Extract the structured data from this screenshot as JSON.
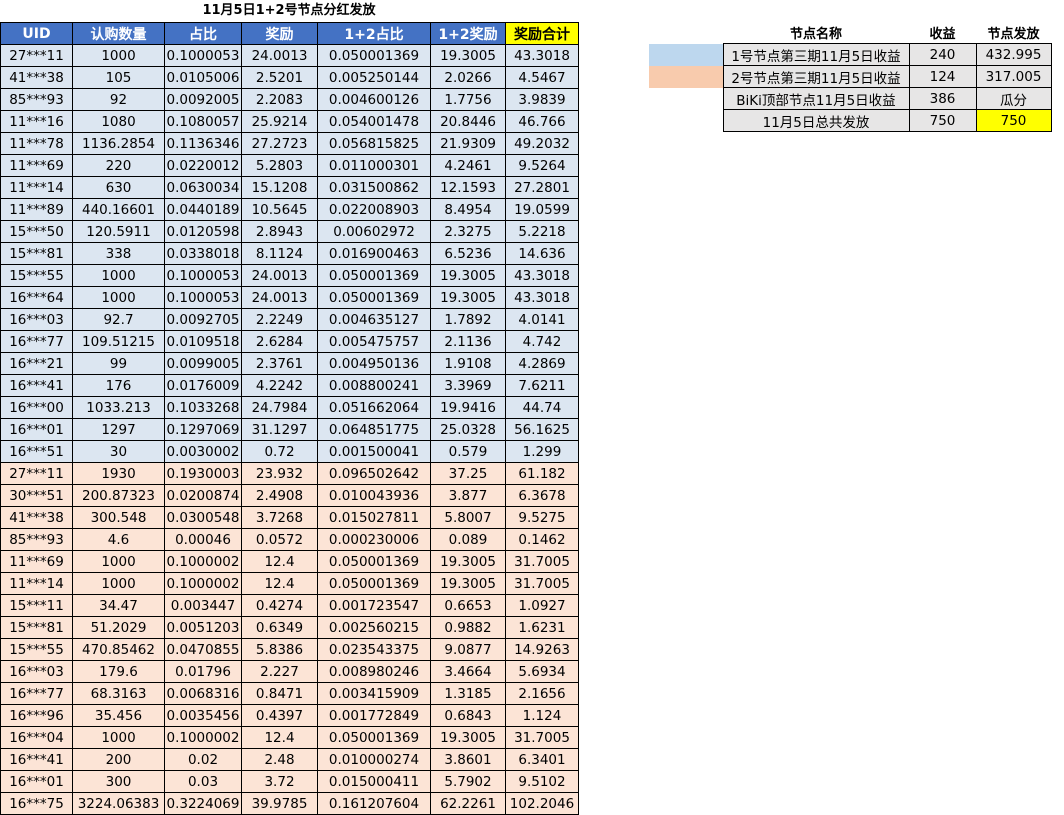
{
  "title": "11月5日1+2号节点分红发放",
  "columns": [
    "UID",
    "认购数量",
    "占比",
    "奖励",
    "1+2占比",
    "1+2奖励",
    "奖励合计"
  ],
  "rows": [
    [
      "27***11",
      "1000",
      "0.1000053",
      "24.0013",
      "0.050001369",
      "19.3005",
      "43.3018"
    ],
    [
      "41***38",
      "105",
      "0.0105006",
      "2.5201",
      "0.005250144",
      "2.0266",
      "4.5467"
    ],
    [
      "85***93",
      "92",
      "0.0092005",
      "2.2083",
      "0.004600126",
      "1.7756",
      "3.9839"
    ],
    [
      "11***16",
      "1080",
      "0.1080057",
      "25.9214",
      "0.054001478",
      "20.8446",
      "46.766"
    ],
    [
      "11***78",
      "1136.2854",
      "0.1136346",
      "27.2723",
      "0.056815825",
      "21.9309",
      "49.2032"
    ],
    [
      "11***69",
      "220",
      "0.0220012",
      "5.2803",
      "0.011000301",
      "4.2461",
      "9.5264"
    ],
    [
      "11***14",
      "630",
      "0.0630034",
      "15.1208",
      "0.031500862",
      "12.1593",
      "27.2801"
    ],
    [
      "11***89",
      "440.16601",
      "0.0440189",
      "10.5645",
      "0.022008903",
      "8.4954",
      "19.0599"
    ],
    [
      "15***50",
      "120.5911",
      "0.0120598",
      "2.8943",
      "0.00602972",
      "2.3275",
      "5.2218"
    ],
    [
      "15***81",
      "338",
      "0.0338018",
      "8.1124",
      "0.016900463",
      "6.5236",
      "14.636"
    ],
    [
      "15***55",
      "1000",
      "0.1000053",
      "24.0013",
      "0.050001369",
      "19.3005",
      "43.3018"
    ],
    [
      "16***64",
      "1000",
      "0.1000053",
      "24.0013",
      "0.050001369",
      "19.3005",
      "43.3018"
    ],
    [
      "16***03",
      "92.7",
      "0.0092705",
      "2.2249",
      "0.004635127",
      "1.7892",
      "4.0141"
    ],
    [
      "16***77",
      "109.51215",
      "0.0109518",
      "2.6284",
      "0.005475757",
      "2.1136",
      "4.742"
    ],
    [
      "16***21",
      "99",
      "0.0099005",
      "2.3761",
      "0.004950136",
      "1.9108",
      "4.2869"
    ],
    [
      "16***41",
      "176",
      "0.0176009",
      "4.2242",
      "0.008800241",
      "3.3969",
      "7.6211"
    ],
    [
      "16***00",
      "1033.213",
      "0.1033268",
      "24.7984",
      "0.051662064",
      "19.9416",
      "44.74"
    ],
    [
      "16***01",
      "1297",
      "0.1297069",
      "31.1297",
      "0.064851775",
      "25.0328",
      "56.1625"
    ],
    [
      "16***51",
      "30",
      "0.0030002",
      "0.72",
      "0.001500041",
      "0.579",
      "1.299"
    ],
    [
      "27***11",
      "1930",
      "0.1930003",
      "23.932",
      "0.096502642",
      "37.25",
      "61.182"
    ],
    [
      "30***51",
      "200.87323",
      "0.0200874",
      "2.4908",
      "0.010043936",
      "3.877",
      "6.3678"
    ],
    [
      "41***38",
      "300.548",
      "0.0300548",
      "3.7268",
      "0.015027811",
      "5.8007",
      "9.5275"
    ],
    [
      "85***93",
      "4.6",
      "0.00046",
      "0.0572",
      "0.000230006",
      "0.089",
      "0.1462"
    ],
    [
      "11***69",
      "1000",
      "0.1000002",
      "12.4",
      "0.050001369",
      "19.3005",
      "31.7005"
    ],
    [
      "11***14",
      "1000",
      "0.1000002",
      "12.4",
      "0.050001369",
      "19.3005",
      "31.7005"
    ],
    [
      "15***11",
      "34.47",
      "0.003447",
      "0.4274",
      "0.001723547",
      "0.6653",
      "1.0927"
    ],
    [
      "15***81",
      "51.2029",
      "0.0051203",
      "0.6349",
      "0.002560215",
      "0.9882",
      "1.6231"
    ],
    [
      "15***55",
      "470.85462",
      "0.0470855",
      "5.8386",
      "0.023543375",
      "9.0877",
      "14.9263"
    ],
    [
      "16***03",
      "179.6",
      "0.01796",
      "2.227",
      "0.008980246",
      "3.4664",
      "5.6934"
    ],
    [
      "16***77",
      "68.3163",
      "0.0068316",
      "0.8471",
      "0.003415909",
      "1.3185",
      "2.1656"
    ],
    [
      "16***96",
      "35.456",
      "0.0035456",
      "0.4397",
      "0.001772849",
      "0.6843",
      "1.124"
    ],
    [
      "16***04",
      "1000",
      "0.1000002",
      "12.4",
      "0.050001369",
      "19.3005",
      "31.7005"
    ],
    [
      "16***41",
      "200",
      "0.02",
      "2.48",
      "0.010000274",
      "3.8601",
      "6.3401"
    ],
    [
      "16***01",
      "300",
      "0.03",
      "3.72",
      "0.015000411",
      "5.7902",
      "9.5102"
    ],
    [
      "16***75",
      "3224.06383",
      "0.3224069",
      "39.9785",
      "0.161207604",
      "62.2261",
      "102.2046"
    ]
  ],
  "blue_row_count": 19,
  "side": {
    "headers": [
      "节点名称",
      "收益",
      "节点发放"
    ],
    "rows": [
      {
        "swatch": "blue",
        "name": "1号节点第三期11月5日收益",
        "income": "240",
        "payout": "432.995"
      },
      {
        "swatch": "peach",
        "name": "2号节点第三期11月5日收益",
        "income": "124",
        "payout": "317.005"
      },
      {
        "swatch": "",
        "name": "BiKi顶部节点11月5日收益",
        "income": "386",
        "payout": "瓜分"
      },
      {
        "swatch": "",
        "name": "11月5日总共发放",
        "income": "750",
        "payout": "750",
        "highlight": true
      }
    ]
  },
  "colors": {
    "header_blue": "#4472c4",
    "row_blue": "#dce6f1",
    "row_peach": "#fce4d6",
    "swatch_blue": "#bdd7ee",
    "swatch_peach": "#f8cbad",
    "highlight_yellow": "#ffff00",
    "side_gray": "#e7e6e6"
  }
}
